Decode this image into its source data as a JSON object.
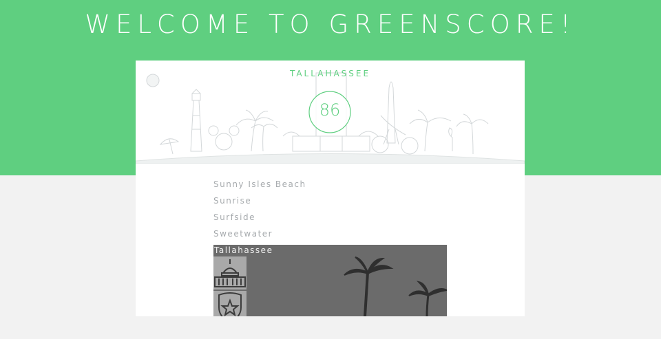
{
  "header": {
    "title": "WELCOME TO GREENSCORE!"
  },
  "hero": {
    "city": "TALLAHASSEE",
    "score": "86"
  },
  "city_list": [
    {
      "label": "Sunny Isles Beach"
    },
    {
      "label": "Sunrise"
    },
    {
      "label": "Surfside"
    },
    {
      "label": "Sweetwater"
    }
  ],
  "selected_city": {
    "label": "Tallahassee",
    "icons": [
      "capitol-building-icon",
      "police-badge-icon"
    ]
  },
  "colors": {
    "accent": "#5fcf80",
    "page_bg": "#f2f2f2",
    "panel_bg": "#6b6b6b"
  }
}
